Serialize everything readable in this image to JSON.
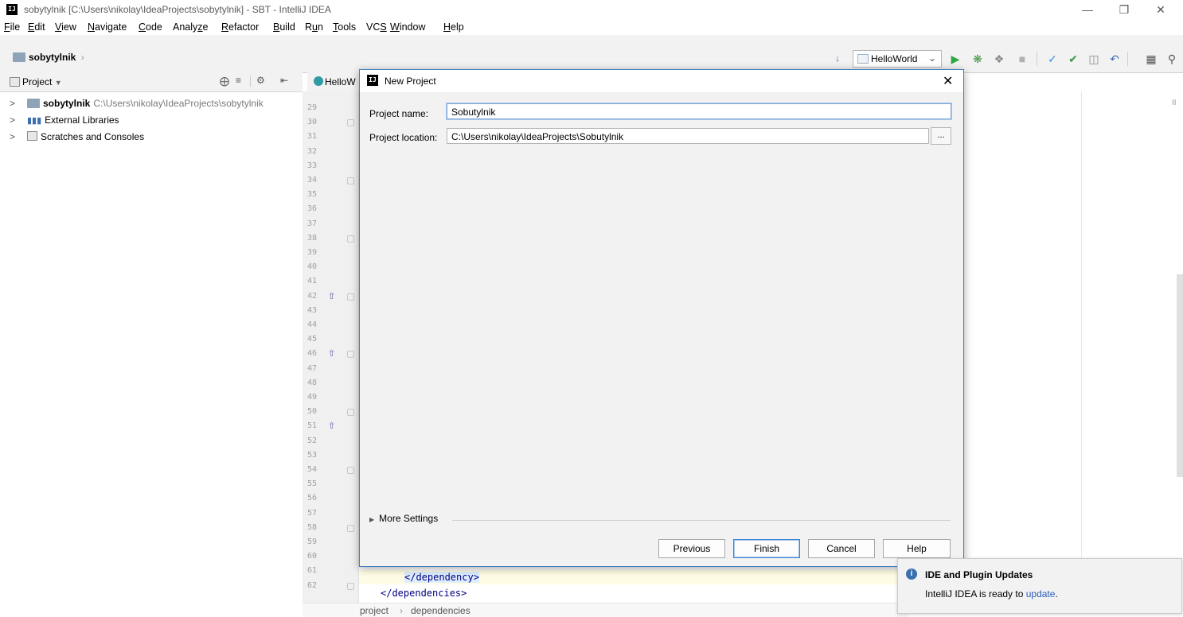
{
  "window": {
    "title": "sobytylnik [C:\\Users\\nikolay\\IdeaProjects\\sobytylnik] - SBT - IntelliJ IDEA",
    "app_icon_text": "IJ"
  },
  "menu": {
    "items": [
      {
        "u": "F",
        "rest": "ile"
      },
      {
        "u": "E",
        "rest": "dit"
      },
      {
        "u": "V",
        "rest": "iew"
      },
      {
        "u": "N",
        "rest": "avigate"
      },
      {
        "u": "C",
        "rest": "ode"
      },
      {
        "pre": "Analy",
        "u": "z",
        "rest": "e"
      },
      {
        "u": "R",
        "rest": "efactor"
      },
      {
        "u": "B",
        "rest": "uild"
      },
      {
        "pre": "R",
        "u": "u",
        "rest": "n"
      },
      {
        "u": "T",
        "rest": "ools"
      },
      {
        "pre": "VC",
        "u": "S",
        "rest": ""
      },
      {
        "u": "W",
        "rest": "indow"
      },
      {
        "u": "H",
        "rest": "elp"
      }
    ]
  },
  "navbar": {
    "breadcrumb": "sobytylnik",
    "run_config": "HelloWorld"
  },
  "project_panel": {
    "title": "Project",
    "tree": [
      {
        "label": "sobytylnik",
        "path": "C:\\Users\\nikolay\\IdeaProjects\\sobytylnik",
        "bold": true
      },
      {
        "label": "External Libraries",
        "path": ""
      },
      {
        "label": "Scratches and Consoles",
        "path": ""
      }
    ]
  },
  "editor": {
    "tab_label": "HelloW",
    "line_numbers": [
      "29",
      "30",
      "31",
      "32",
      "33",
      "34",
      "35",
      "36",
      "37",
      "38",
      "39",
      "40",
      "41",
      "42",
      "43",
      "44",
      "45",
      "46",
      "47",
      "48",
      "49",
      "50",
      "51",
      "52",
      "53",
      "54",
      "55",
      "56",
      "57",
      "58",
      "59",
      "60",
      "61",
      "62"
    ],
    "visible_code": [
      {
        "line": "61",
        "text": "</dependency>"
      },
      {
        "line": "62",
        "text": "</dependencies>"
      }
    ],
    "breadcrumb": [
      "project",
      "dependencies"
    ]
  },
  "dialog": {
    "title": "New Project",
    "project_name_label": "Project name:",
    "project_name_value": "Sobutylnik",
    "project_location_label": "Project location:",
    "project_location_value": "C:\\Users\\nikolay\\IdeaProjects\\Sobutylnik",
    "browse_label": "...",
    "more_settings": "More Settings",
    "buttons": {
      "previous": "Previous",
      "finish": "Finish",
      "cancel": "Cancel",
      "help": "Help"
    }
  },
  "notification": {
    "title": "IDE and Plugin Updates",
    "message": "IntelliJ IDEA is ready to",
    "link": "update",
    "suffix": "."
  }
}
